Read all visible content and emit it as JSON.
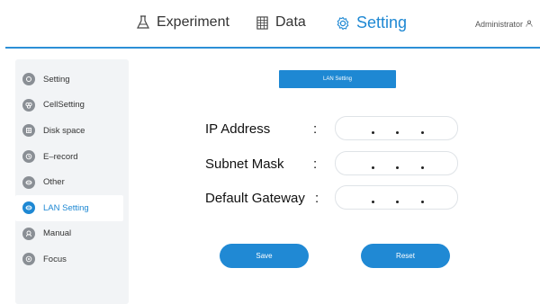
{
  "nav": {
    "experiment": "Experiment",
    "data": "Data",
    "setting": "Setting",
    "user": "Administrator",
    "experiment_icon": "flask-icon",
    "data_icon": "data-grid-icon",
    "setting_icon": "gear-icon",
    "user_icon": "user-icon"
  },
  "sidebar": {
    "items": [
      {
        "label": "Setting",
        "icon": "setting-icon"
      },
      {
        "label": "CellSetting",
        "icon": "cell-icon"
      },
      {
        "label": "Disk space",
        "icon": "disk-icon"
      },
      {
        "label": "E–record",
        "icon": "record-icon"
      },
      {
        "label": "Other",
        "icon": "other-icon"
      },
      {
        "label": "LAN Setting",
        "icon": "lan-icon"
      },
      {
        "label": "Manual",
        "icon": "manual-icon"
      },
      {
        "label": "Focus",
        "icon": "focus-icon"
      }
    ],
    "active_index": 5
  },
  "main": {
    "section_title": "LAN Setting",
    "fields": [
      {
        "label": "IP Address",
        "colon": ":",
        "value": ". . ."
      },
      {
        "label": "Subnet Mask",
        "colon": ":",
        "value": ". . ."
      },
      {
        "label": "Default Gateway",
        "colon": ":",
        "value": ". . ."
      }
    ],
    "save_label": "Save",
    "reset_label": "Reset"
  },
  "colors": {
    "accent": "#1e88d3",
    "sidebar_bg": "#f2f4f6"
  }
}
